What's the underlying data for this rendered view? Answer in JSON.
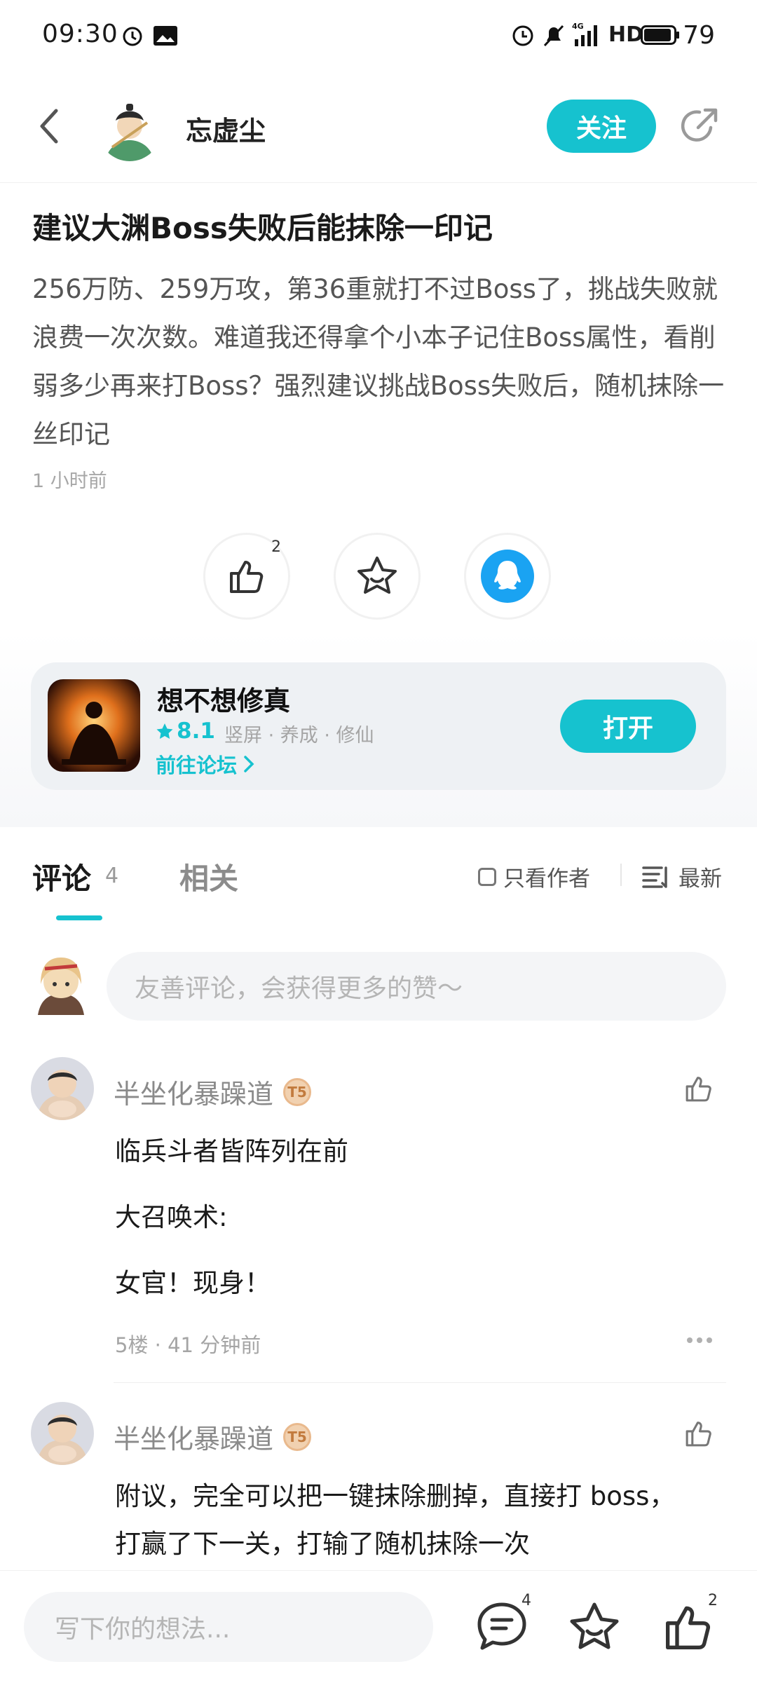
{
  "status_bar": {
    "time": "09:30",
    "battery": "79"
  },
  "header": {
    "author_name": "忘虚尘",
    "follow_label": "关注"
  },
  "post": {
    "title": "建议大渊Boss失败后能抹除一印记",
    "body": "256万防、259万攻，第36重就打不过Boss了，挑战失败就浪费一次次数。难道我还得拿个小本子记住Boss属性，看削弱多少再来打Boss？强烈建议挑战Boss失败后，随机抹除一丝印记",
    "time": "1 小时前",
    "like_count": "2"
  },
  "game_card": {
    "name": "想不想修真",
    "score": "8.1",
    "tags": "竖屏 · 养成 · 修仙",
    "forum_link": "前往论坛",
    "open_label": "打开"
  },
  "comments_section": {
    "tab_comments": "评论",
    "comment_count": "4",
    "tab_related": "相关",
    "only_author": "只看作者",
    "sort": "最新",
    "input_placeholder": "友善评论，会获得更多的赞～"
  },
  "comments": [
    {
      "user": "半坐化暴躁道",
      "lines": [
        "临兵斗者皆阵列在前",
        "大召唤术:",
        "女官！现身！"
      ],
      "meta": "5楼 · 41 分钟前"
    },
    {
      "user": "半坐化暴躁道",
      "lines": [
        "附议，完全可以把一键抹除删掉，直接打 boss，",
        "打赢了下一关，打输了随机抹除一次"
      ]
    }
  ],
  "badge_text": "T5",
  "bottom_bar": {
    "placeholder": "写下你的想法...",
    "comment_count": "4",
    "like_count": "2"
  },
  "colors": {
    "accent": "#16c2cf",
    "qq_blue": "#1aa3f2"
  }
}
